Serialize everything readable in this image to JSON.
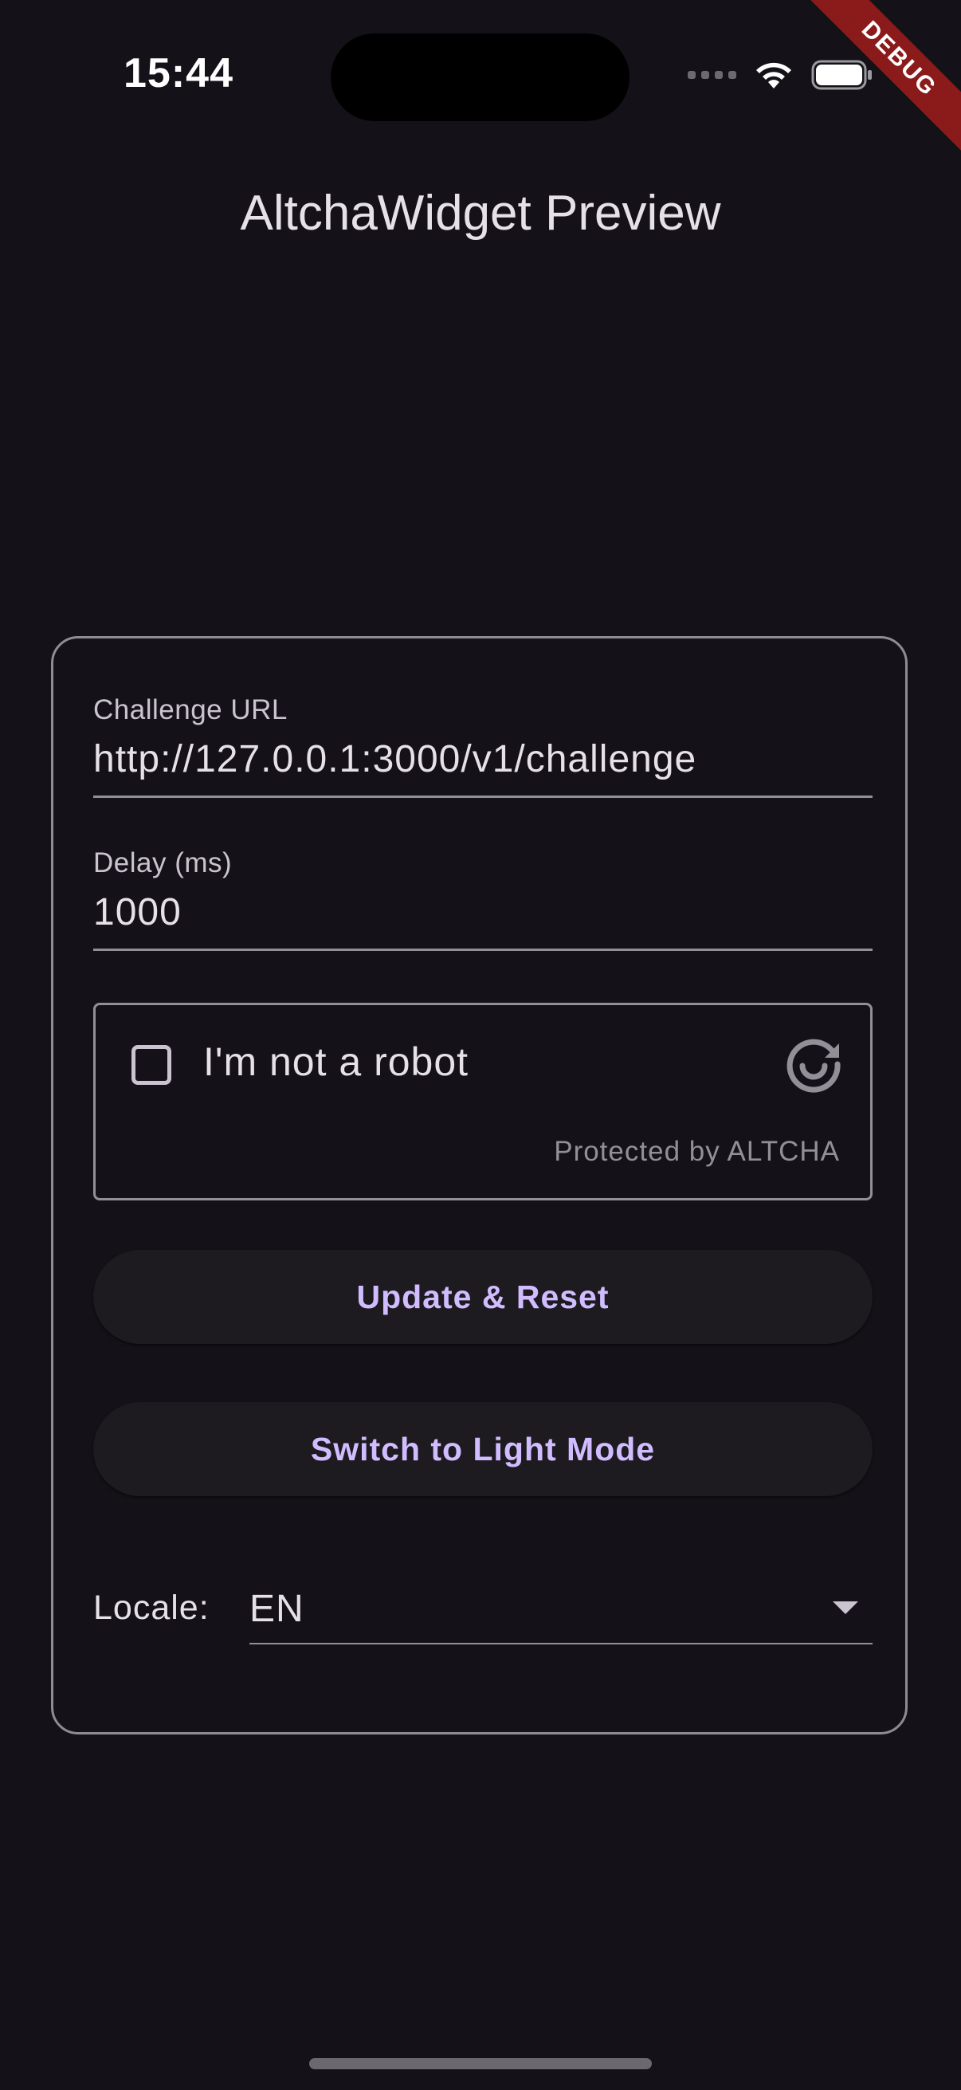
{
  "status_bar": {
    "time": "15:44"
  },
  "debug_banner": "DEBUG",
  "app_bar": {
    "title": "AltchaWidget Preview"
  },
  "form": {
    "challenge_url": {
      "label": "Challenge URL",
      "value": "http://127.0.0.1:3000/v1/challenge"
    },
    "delay": {
      "label": "Delay (ms)",
      "value": "1000"
    },
    "captcha": {
      "label": "I'm not a robot",
      "checked": false,
      "footer": "Protected by ALTCHA",
      "icon": "refresh-icon"
    },
    "update_button": "Update & Reset",
    "theme_button": "Switch to Light Mode",
    "locale": {
      "label": "Locale:",
      "value": "EN"
    }
  },
  "colors": {
    "background": "#141218",
    "accent": "#d0bcff",
    "debug_ribbon": "#8b1a1a"
  }
}
